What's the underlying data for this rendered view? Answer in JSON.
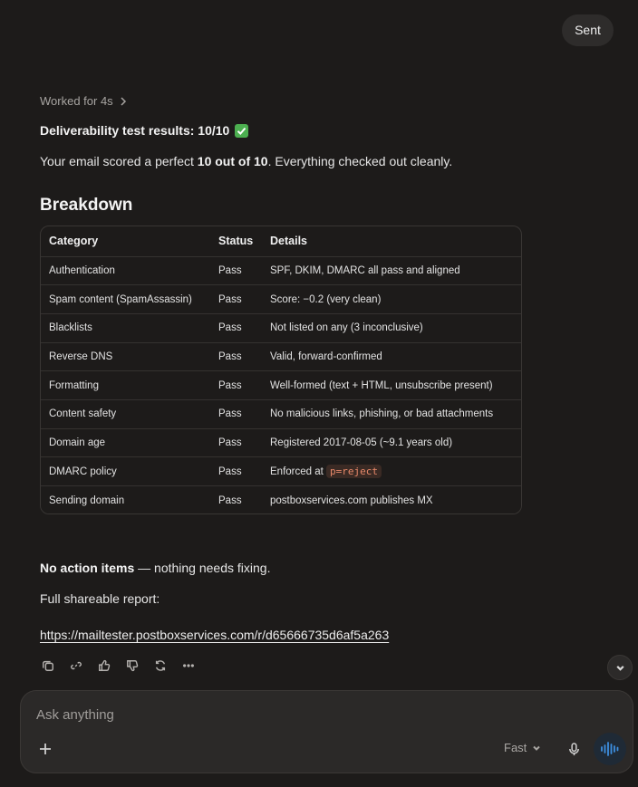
{
  "message": {
    "sent_text": "Sent"
  },
  "response": {
    "worked_label": "Worked for 4s",
    "title": "Deliverability test results: 10/10",
    "summary_prefix": "Your email scored a perfect ",
    "summary_bold": "10 out of 10",
    "summary_suffix": ". Everything checked out cleanly.",
    "breakdown_title": "Breakdown",
    "table": {
      "headers": [
        "Category",
        "Status",
        "Details"
      ],
      "rows": [
        {
          "category": "Authentication",
          "status": "Pass",
          "details": "SPF, DKIM, DMARC all pass and aligned"
        },
        {
          "category": "Spam content (SpamAssassin)",
          "status": "Pass",
          "details": "Score: −0.2 (very clean)"
        },
        {
          "category": "Blacklists",
          "status": "Pass",
          "details": "Not listed on any (3 inconclusive)"
        },
        {
          "category": "Reverse DNS",
          "status": "Pass",
          "details": "Valid, forward-confirmed"
        },
        {
          "category": "Formatting",
          "status": "Pass",
          "details": "Well-formed (text + HTML, unsubscribe present)"
        },
        {
          "category": "Content safety",
          "status": "Pass",
          "details": "No malicious links, phishing, or bad attachments"
        },
        {
          "category": "Domain age",
          "status": "Pass",
          "details": "Registered 2017-08-05 (~9.1 years old)"
        },
        {
          "category": "DMARC policy",
          "status": "Pass",
          "details": "Enforced at ",
          "code": "p=reject"
        },
        {
          "category": "Sending domain",
          "status": "Pass",
          "details": "postboxservices.com publishes MX"
        }
      ]
    },
    "no_action_bold": "No action items",
    "no_action_rest": " — nothing needs fixing.",
    "report_label": "Full shareable report:",
    "report_link": "https://mailtester.postboxservices.com/r/d65666735d6af5a263"
  },
  "composer": {
    "placeholder": "Ask anything",
    "mode": "Fast"
  },
  "icons": {
    "actions": [
      "copy-icon",
      "link-icon",
      "thumbs-up-icon",
      "thumbs-down-icon",
      "regenerate-icon",
      "more-icon"
    ],
    "accent_voice": "#3d8fe0",
    "pass_check": "#4caf50"
  }
}
